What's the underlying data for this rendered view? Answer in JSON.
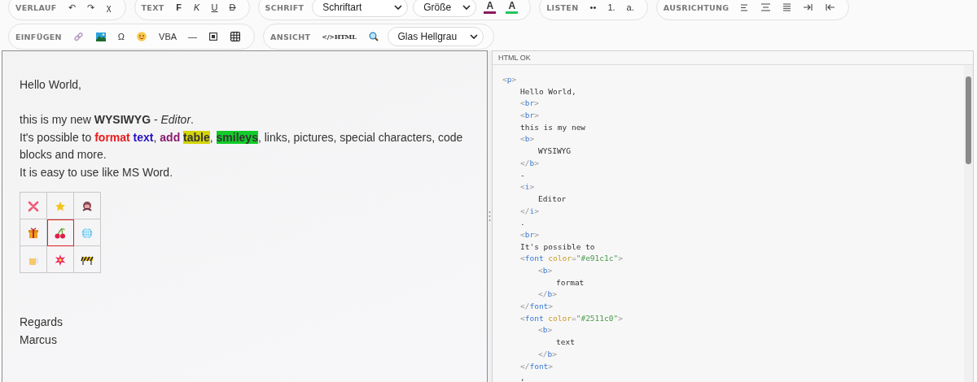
{
  "toolbar_row_1": {
    "groups": [
      {
        "label": "VERLAUF",
        "items": [
          {
            "kind": "glyph",
            "text": "↶"
          },
          {
            "kind": "glyph",
            "text": "↷"
          },
          {
            "kind": "glyph",
            "text": "χ"
          }
        ]
      },
      {
        "label": "TEXT",
        "items": [
          {
            "kind": "glyph",
            "text": "F"
          },
          {
            "kind": "glyph",
            "text": "K"
          },
          {
            "kind": "glyph",
            "text": "U"
          },
          {
            "kind": "glyph",
            "text": "D"
          }
        ]
      },
      {
        "label": "SCHRIFT",
        "items": [
          {
            "kind": "select",
            "value": "Schriftart"
          },
          {
            "kind": "select",
            "value": "Größe"
          },
          {
            "kind": "color",
            "text": "A",
            "color": "#8a1a5e"
          },
          {
            "kind": "color",
            "text": "A",
            "color": "#22c55e"
          }
        ]
      },
      {
        "label": "LISTEN",
        "items": [
          {
            "kind": "glyph",
            "text": "••"
          },
          {
            "kind": "glyph",
            "text": "1."
          },
          {
            "kind": "glyph",
            "text": "a."
          }
        ]
      },
      {
        "label": "AUSRICHTUNG",
        "items": [
          {
            "kind": "icon"
          },
          {
            "kind": "icon"
          },
          {
            "kind": "icon"
          },
          {
            "kind": "icon"
          },
          {
            "kind": "icon"
          }
        ]
      }
    ]
  },
  "toolbar_row_2": {
    "groups": [
      {
        "label": "EINFÜGEN",
        "items": [
          {
            "kind": "icon"
          },
          {
            "kind": "icon"
          },
          {
            "kind": "glyph",
            "text": "Ω"
          },
          {
            "kind": "icon"
          },
          {
            "kind": "glyph",
            "text": "VBA"
          },
          {
            "kind": "glyph",
            "text": "—"
          },
          {
            "kind": "icon"
          },
          {
            "kind": "icon"
          }
        ]
      },
      {
        "label": "ANSICHT",
        "items": [
          {
            "kind": "glyph",
            "text": "</>HTML"
          },
          {
            "kind": "icon"
          },
          {
            "kind": "select",
            "value": "Glas Hellgrau"
          }
        ]
      }
    ]
  },
  "editor": {
    "lines": [
      [
        {
          "text": "Hello World,"
        }
      ],
      [
        {
          "text": "this is my new "
        },
        {
          "text": "WYSIWYG",
          "bold": true
        },
        {
          "text": " - "
        },
        {
          "text": "Editor",
          "italic": true
        },
        {
          "text": "."
        }
      ],
      [
        {
          "text": "It's possible to "
        },
        {
          "text": "format",
          "bold": true,
          "color": "#e91c1c"
        },
        {
          "text": " text",
          "bold": true,
          "color": "#2511c0"
        },
        {
          "text": ", "
        },
        {
          "text": "add ",
          "bold": true,
          "color": "#8a1a6e"
        },
        {
          "text": "table",
          "bold": true,
          "kind": "highlight",
          "color": "#d4d40a"
        },
        {
          "text": ", "
        },
        {
          "text": "smileys",
          "bold": true,
          "kind": "highlight",
          "color": "#13cc2a"
        },
        {
          "text": ", links, pictures, special characters, code"
        }
      ],
      [
        {
          "text": "blocks and more."
        }
      ],
      [
        {
          "text": "It is easy to use like MS Word."
        }
      ]
    ],
    "emoji_table": [
      [
        {
          "selected": false
        },
        {
          "selected": false
        },
        {
          "selected": false
        }
      ],
      [
        {
          "selected": false
        },
        {
          "selected": true
        },
        {
          "selected": false
        }
      ],
      [
        {
          "selected": false
        },
        {
          "selected": false
        },
        {
          "selected": false
        }
      ]
    ],
    "closing_lines": [
      [
        {
          "text": "Regards"
        }
      ],
      [
        {
          "text": "Marcus"
        }
      ]
    ]
  },
  "html_panel": {
    "status": "HTML OK",
    "code": [
      {
        "open": "<p>",
        "children": [
          {
            "text": "Hello World,"
          },
          {
            "open": "<br>"
          },
          {
            "open": "<br>"
          },
          {
            "text": "this is my new"
          },
          {
            "open": "<b>",
            "close": "</b>",
            "children": [
              {
                "text": "WYSIWYG"
              }
            ]
          },
          {
            "text": "-"
          },
          {
            "open": "<i>",
            "close": "</i>",
            "children": [
              {
                "text": "Editor"
              }
            ]
          },
          {
            "text": "."
          },
          {
            "open": "<br>"
          },
          {
            "text": "It's possible to"
          },
          {
            "open": "<font color=\"#e91c1c\">",
            "close": "</font>",
            "children": [
              {
                "open": "<b>",
                "close": "</b>",
                "children": [
                  {
                    "text": "format"
                  }
                ]
              }
            ]
          },
          {
            "open": "<font color=\"#2511c0\">",
            "close": "</font>",
            "children": [
              {
                "open": "<b>",
                "close": "</b>",
                "children": [
                  {
                    "text": "text"
                  }
                ]
              }
            ]
          },
          {
            "text": ","
          }
        ]
      }
    ]
  }
}
